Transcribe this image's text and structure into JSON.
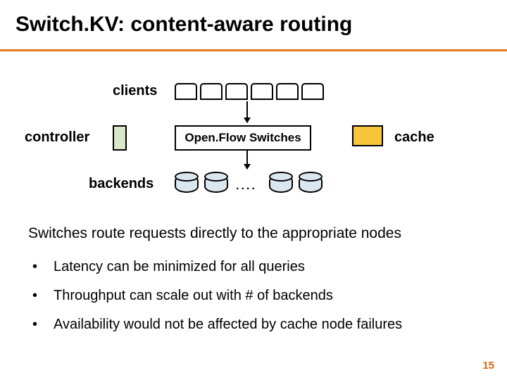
{
  "title": "Switch.KV: content-aware routing",
  "labels": {
    "clients": "clients",
    "controller": "controller",
    "cache": "cache",
    "backends": "backends",
    "switchbox": "Open.Flow Switches",
    "dots": "...."
  },
  "summary": "Switches route requests directly to the appropriate nodes",
  "bullets": [
    "Latency can be minimized for all queries",
    "Throughput can scale out with # of backends",
    "Availability would not be affected by cache node failures"
  ],
  "page": "15"
}
